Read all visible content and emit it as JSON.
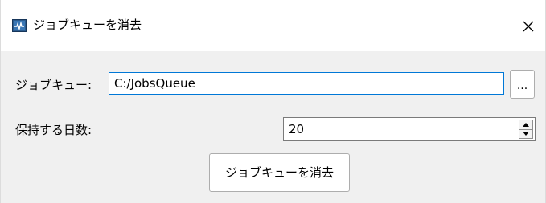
{
  "window": {
    "title": "ジョブキューを消去"
  },
  "form": {
    "queue_label": "ジョブキュー:",
    "queue_value": "C:/JobsQueue",
    "browse_label": "...",
    "days_label": "保持する日数:",
    "days_value": "20"
  },
  "actions": {
    "clear_label": "ジョブキューを消去"
  },
  "icons": {
    "app": "app-window-icon",
    "close": "close-icon",
    "spin_up": "spin-up-icon",
    "spin_down": "spin-down-icon"
  },
  "colors": {
    "focus_border": "#0078d7",
    "title_bar_bg": "#ffffff",
    "dialog_bg": "#f0f0f0"
  }
}
